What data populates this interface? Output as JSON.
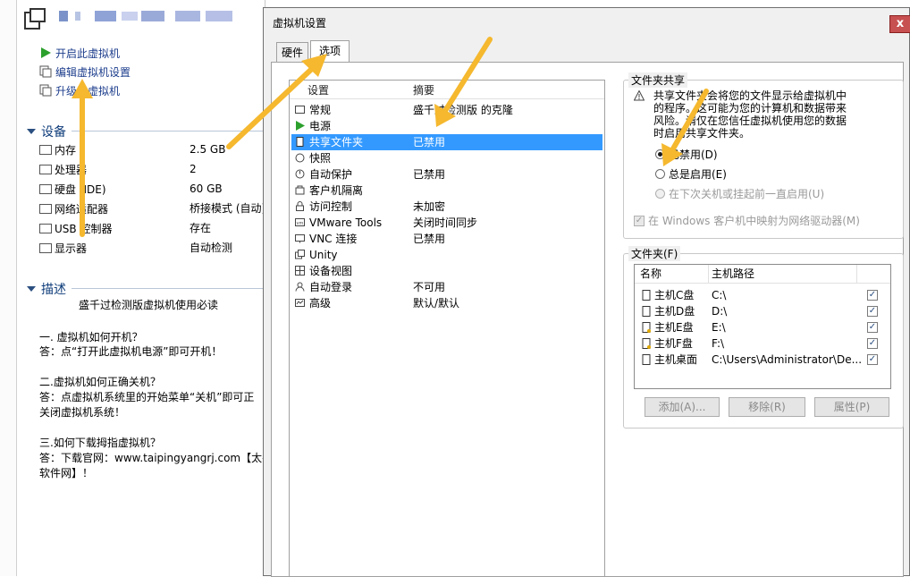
{
  "left": {
    "actions": [
      {
        "label": "开启此虚拟机",
        "icon": "play-icon"
      },
      {
        "label": "编辑虚拟机设置",
        "icon": "edit-settings-icon"
      },
      {
        "label": "升级此虚拟机",
        "icon": "upgrade-icon"
      }
    ],
    "devices_heading": "设备",
    "devices": [
      {
        "name": "内存",
        "value": "2.5 GB",
        "icon": "memory-icon"
      },
      {
        "name": "处理器",
        "value": "2",
        "icon": "cpu-icon"
      },
      {
        "name": "硬盘 (IDE)",
        "value": "60 GB",
        "icon": "hard-disk-icon"
      },
      {
        "name": "网络适配器",
        "value": "桥接模式 (自动)",
        "icon": "network-icon"
      },
      {
        "name": "USB 控制器",
        "value": "存在",
        "icon": "usb-icon"
      },
      {
        "name": "显示器",
        "value": "自动检测",
        "icon": "display-icon"
      }
    ],
    "description_heading": "描述",
    "description_lines": [
      "盛千过检测版虚拟机使用必读",
      "",
      "一. 虚拟机如何开机？",
      "答：点“打开此虚拟机电源”即可开机！",
      "",
      "二.虚拟机如何正确关机？",
      "答：点虚拟机系统里的开始菜单“关机”即可正",
      "关闭虚拟机系统！",
      "",
      "三.如何下载拇指虚拟机？",
      "答：下载官网：www.taipingyangrj.com【太平",
      "软件网】！"
    ]
  },
  "dialog": {
    "title": "虚拟机设置",
    "close_label": "x",
    "tabs": [
      {
        "label": "硬件"
      },
      {
        "label": "选项"
      }
    ],
    "settings_header": {
      "col1": "设置",
      "col2": "摘要"
    },
    "settings": [
      {
        "name": "常规",
        "summary": "盛千过检测版 的克隆",
        "icon": "general-icon"
      },
      {
        "name": "电源",
        "summary": "",
        "icon": "power-icon"
      },
      {
        "name": "共享文件夹",
        "summary": "已禁用",
        "icon": "shared-folder-icon",
        "selected": true
      },
      {
        "name": "快照",
        "summary": "",
        "icon": "snapshot-icon"
      },
      {
        "name": "自动保护",
        "summary": "已禁用",
        "icon": "autoprotect-icon"
      },
      {
        "name": "客户机隔离",
        "summary": "",
        "icon": "isolation-icon"
      },
      {
        "name": "访问控制",
        "summary": "未加密",
        "icon": "lock-icon"
      },
      {
        "name": "VMware Tools",
        "summary": "关闭时间同步",
        "icon": "vmware-tools-icon"
      },
      {
        "name": "VNC 连接",
        "summary": "已禁用",
        "icon": "vnc-icon"
      },
      {
        "name": "Unity",
        "summary": "",
        "icon": "unity-icon"
      },
      {
        "name": "设备视图",
        "summary": "",
        "icon": "device-view-icon"
      },
      {
        "name": "自动登录",
        "summary": "不可用",
        "icon": "autologin-icon"
      },
      {
        "name": "高级",
        "summary": "默认/默认",
        "icon": "advanced-icon"
      }
    ],
    "folder_sharing": {
      "label": "文件夹共享",
      "warning_lines": [
        "共享文件夹会将您的文件显示给虚拟机中",
        "的程序。这可能为您的计算机和数据带来",
        "风险。请仅在您信任虚拟机使用您的数据",
        "时启用共享文件夹。"
      ],
      "options": [
        {
          "label": "已禁用(D)",
          "checked": true,
          "disabled": false
        },
        {
          "label": "总是启用(E)",
          "checked": false,
          "disabled": false
        },
        {
          "label": "在下次关机或挂起前一直启用(U)",
          "checked": false,
          "disabled": true
        }
      ],
      "map_drive_label": "在 Windows 客户机中映射为网络驱动器(M)"
    },
    "folders": {
      "label": "文件夹(F)",
      "col_name": "名称",
      "col_path": "主机路径",
      "rows": [
        {
          "name": "主机C盘",
          "path": "C:\\"
        },
        {
          "name": "主机D盘",
          "path": "D:\\"
        },
        {
          "name": "主机E盘",
          "path": "E:\\"
        },
        {
          "name": "主机F盘",
          "path": "F:\\"
        },
        {
          "name": "主机桌面",
          "path": "C:\\Users\\Administrator\\De..."
        }
      ],
      "buttons": {
        "add": "添加(A)...",
        "remove": "移除(R)",
        "properties": "属性(P)"
      }
    }
  },
  "colors": {
    "accent": "#f5b82e",
    "selection": "#3399ff",
    "link": "#1c3d8c"
  }
}
